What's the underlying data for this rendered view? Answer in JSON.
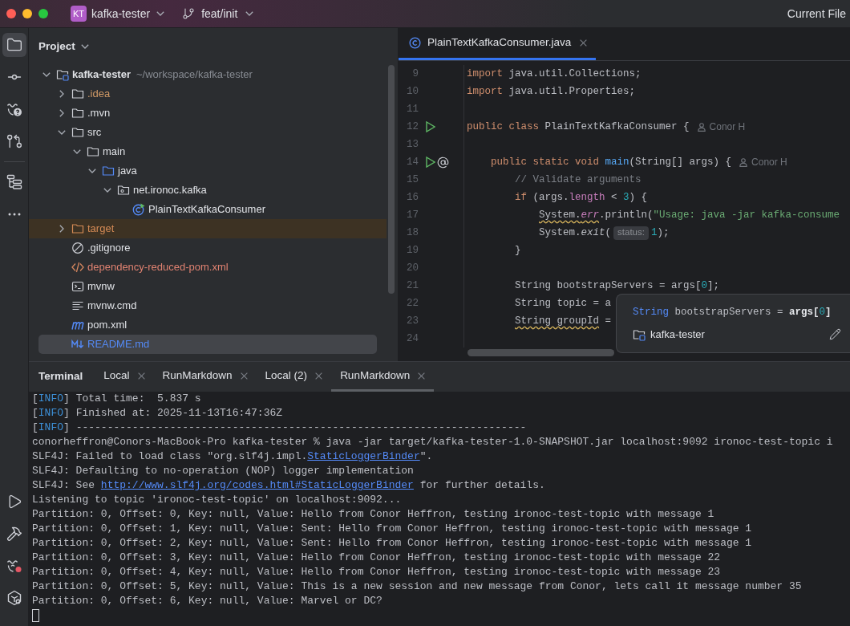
{
  "title_bar": {
    "project_badge": "KT",
    "project": "kafka-tester",
    "branch": "feat/init",
    "run_configuration": "Current File"
  },
  "tool_strip": {
    "top": [
      {
        "kind": "project",
        "selected": true
      },
      {
        "kind": "commit",
        "selected": false
      },
      {
        "kind": "problems",
        "selected": false
      },
      {
        "kind": "pull_requests",
        "selected": false
      },
      {
        "kind": "structure",
        "selected": false
      },
      {
        "kind": "more",
        "selected": false
      }
    ],
    "bottom": [
      {
        "kind": "run",
        "selected": false
      },
      {
        "kind": "build",
        "selected": false
      },
      {
        "kind": "problems_alert",
        "selected": false
      },
      {
        "kind": "services",
        "selected": false
      }
    ]
  },
  "project_panel": {
    "title": "Project",
    "tree": [
      {
        "label": "kafka-tester",
        "location": "~/workspace/kafka-tester",
        "kind": "module",
        "expanded": true,
        "selected": false,
        "color": "#dfe1e5",
        "children": [
          {
            "label": ".idea",
            "kind": "folder",
            "expanded": false,
            "selected": false,
            "color": "#d19a66"
          },
          {
            "label": ".mvn",
            "kind": "folder",
            "expanded": false,
            "selected": false,
            "color": "#dfe1e5"
          },
          {
            "label": "src",
            "kind": "folder",
            "expanded": true,
            "selected": false,
            "color": "#dfe1e5",
            "children": [
              {
                "label": "main",
                "kind": "folder",
                "expanded": true,
                "selected": false,
                "color": "#dfe1e5",
                "children": [
                  {
                    "label": "java",
                    "kind": "source_root",
                    "expanded": true,
                    "selected": false,
                    "color": "#dfe1e5",
                    "children": [
                      {
                        "label": "net.ironoc.kafka",
                        "kind": "package",
                        "expanded": true,
                        "selected": false,
                        "color": "#dfe1e5",
                        "children": [
                          {
                            "label": "PlainTextKafkaConsumer",
                            "kind": "class",
                            "selected": false,
                            "color": "#dfe1e5"
                          }
                        ]
                      }
                    ]
                  }
                ]
              }
            ]
          },
          {
            "label": "target",
            "kind": "excluded_folder",
            "expanded": false,
            "selected": false,
            "color": "#d48a55"
          },
          {
            "label": ".gitignore",
            "kind": "ignore_file",
            "selected": false,
            "color": "#dfe1e5"
          },
          {
            "label": "dependency-reduced-pom.xml",
            "kind": "xml_file",
            "selected": false,
            "color": "#e08271"
          },
          {
            "label": "mvnw",
            "kind": "script_file",
            "selected": false,
            "color": "#dfe1e5"
          },
          {
            "label": "mvnw.cmd",
            "kind": "text_file",
            "selected": false,
            "color": "#dfe1e5"
          },
          {
            "label": "pom.xml",
            "kind": "maven_file",
            "selected": false,
            "color": "#dfe1e5"
          },
          {
            "label": "README.md",
            "kind": "markdown_file",
            "selected": true,
            "color": "#548af7"
          }
        ]
      }
    ]
  },
  "editor": {
    "tabs": [
      {
        "label": "PlainTextKafkaConsumer.java",
        "selected": true
      }
    ],
    "lines": [
      {
        "number": "9",
        "tokens": [
          {
            "text": "import",
            "kind": "keyword"
          },
          {
            "text": " java.util.Collections;",
            "kind": "plain"
          }
        ]
      },
      {
        "number": "10",
        "tokens": [
          {
            "text": "import",
            "kind": "keyword"
          },
          {
            "text": " java.util.Properties;",
            "kind": "plain"
          }
        ]
      },
      {
        "number": "11"
      },
      {
        "number": "12",
        "markers": [
          {
            "kind": "run"
          }
        ],
        "tokens": [
          {
            "text": "public class",
            "kind": "keyword"
          },
          {
            "text": " PlainTextKafkaConsumer {",
            "kind": "plain"
          },
          {
            "text": "Conor H",
            "kind": "author"
          }
        ]
      },
      {
        "number": "13"
      },
      {
        "number": "14",
        "markers": [
          {
            "kind": "run"
          },
          {
            "kind": "implements"
          }
        ],
        "tokens": [
          {
            "text": "    public static void ",
            "kind": "keyword"
          },
          {
            "text": "main",
            "kind": "method"
          },
          {
            "text": "(String[] args) {",
            "kind": "plain"
          },
          {
            "text": "Conor H",
            "kind": "author"
          }
        ]
      },
      {
        "number": "15",
        "tokens": [
          {
            "text": "        // Validate arguments",
            "kind": "comment"
          }
        ]
      },
      {
        "number": "16",
        "tokens": [
          {
            "text": "        if",
            "kind": "keyword"
          },
          {
            "text": " (args.",
            "kind": "plain"
          },
          {
            "text": "length",
            "kind": "field"
          },
          {
            "text": " < ",
            "kind": "plain"
          },
          {
            "text": "3",
            "kind": "number"
          },
          {
            "text": ") {",
            "kind": "plain"
          }
        ]
      },
      {
        "number": "17",
        "tokens": [
          {
            "text": "            System.",
            "kind": "warning_plain"
          },
          {
            "text": "err",
            "kind": "warning_static_field"
          },
          {
            "text": ".println(",
            "kind": "plain"
          },
          {
            "text": "\"Usage: java -jar kafka-consume",
            "kind": "string"
          }
        ]
      },
      {
        "number": "18",
        "tokens": [
          {
            "text": "            System.",
            "kind": "plain"
          },
          {
            "text": "exit",
            "kind": "static_method"
          },
          {
            "text": "(",
            "kind": "plain"
          },
          {
            "text": "status:",
            "kind": "inlay"
          },
          {
            "text": "1",
            "kind": "number"
          },
          {
            "text": ");",
            "kind": "plain"
          }
        ]
      },
      {
        "number": "19",
        "tokens": [
          {
            "text": "        }",
            "kind": "plain"
          }
        ]
      },
      {
        "number": "20"
      },
      {
        "number": "21",
        "tokens": [
          {
            "text": "        String bootstrapServers = args[",
            "kind": "plain"
          },
          {
            "text": "0",
            "kind": "number"
          },
          {
            "text": "];",
            "kind": "plain"
          }
        ]
      },
      {
        "number": "22",
        "tokens": [
          {
            "text": "        String topic = a",
            "kind": "plain"
          }
        ]
      },
      {
        "number": "23",
        "tokens": [
          {
            "text": "        String groupId",
            "kind": "warning_plain"
          },
          {
            "text": " =",
            "kind": "plain"
          }
        ]
      },
      {
        "number": "24"
      }
    ],
    "popup": {
      "signature": [
        {
          "text": "String",
          "kind": "type"
        },
        {
          "text": " bootstrapServers = ",
          "kind": "plain"
        },
        {
          "text": "args[",
          "kind": "emphasis"
        },
        {
          "text": "0",
          "kind": "number"
        },
        {
          "text": "]",
          "kind": "emphasis"
        }
      ],
      "module": "kafka-tester"
    }
  },
  "terminal": {
    "title": "Terminal",
    "tabs": [
      {
        "label": "Local",
        "selected": false
      },
      {
        "label": "RunMarkdown",
        "selected": false
      },
      {
        "label": "Local (2)",
        "selected": false
      },
      {
        "label": "RunMarkdown",
        "selected": true
      }
    ],
    "lines": [
      {
        "segments": [
          {
            "text": "[",
            "kind": "plain"
          },
          {
            "text": "INFO",
            "kind": "info"
          },
          {
            "text": "] Total time:  5.837 s",
            "kind": "plain"
          }
        ]
      },
      {
        "segments": [
          {
            "text": "[",
            "kind": "plain"
          },
          {
            "text": "INFO",
            "kind": "info"
          },
          {
            "text": "] Finished at: 2025-11-13T16:47:36Z",
            "kind": "plain"
          }
        ]
      },
      {
        "segments": [
          {
            "text": "[",
            "kind": "plain"
          },
          {
            "text": "INFO",
            "kind": "info"
          },
          {
            "text": "] ------------------------------------------------------------------------",
            "kind": "plain"
          }
        ]
      },
      {
        "segments": [
          {
            "text": "conorheffron@Conors-MacBook-Pro kafka-tester % java -jar target/kafka-tester-1.0-SNAPSHOT.jar localhost:9092 ironoc-test-topic i",
            "kind": "plain"
          }
        ]
      },
      {
        "segments": [
          {
            "text": "SLF4J: Failed to load class \"org.slf4j.impl.",
            "kind": "plain"
          },
          {
            "text": "StaticLoggerBinder",
            "kind": "link"
          },
          {
            "text": "\".",
            "kind": "plain"
          }
        ]
      },
      {
        "segments": [
          {
            "text": "SLF4J: Defaulting to no-operation (NOP) logger implementation",
            "kind": "plain"
          }
        ]
      },
      {
        "segments": [
          {
            "text": "SLF4J: See ",
            "kind": "plain"
          },
          {
            "text": "http://www.slf4j.org/codes.html#StaticLoggerBinder",
            "kind": "link"
          },
          {
            "text": " for further details.",
            "kind": "plain"
          }
        ]
      },
      {
        "segments": [
          {
            "text": "Listening to topic 'ironoc-test-topic' on localhost:9092...",
            "kind": "plain"
          }
        ]
      },
      {
        "segments": [
          {
            "text": "Partition: 0, Offset: 0, Key: null, Value: Hello from Conor Heffron, testing ironoc-test-topic with message 1",
            "kind": "plain"
          }
        ]
      },
      {
        "segments": [
          {
            "text": "Partition: 0, Offset: 1, Key: null, Value: Sent: Hello from Conor Heffron, testing ironoc-test-topic with message 1",
            "kind": "plain"
          }
        ]
      },
      {
        "segments": [
          {
            "text": "Partition: 0, Offset: 2, Key: null, Value: Sent: Hello from Conor Heffron, testing ironoc-test-topic with message 1",
            "kind": "plain"
          }
        ]
      },
      {
        "segments": [
          {
            "text": "Partition: 0, Offset: 3, Key: null, Value: Hello from Conor Heffron, testing ironoc-test-topic with message 22",
            "kind": "plain"
          }
        ]
      },
      {
        "segments": [
          {
            "text": "Partition: 0, Offset: 4, Key: null, Value: Hello from Conor Heffron, testing ironoc-test-topic with message 23",
            "kind": "plain"
          }
        ]
      },
      {
        "segments": [
          {
            "text": "Partition: 0, Offset: 5, Key: null, Value: This is a new session and new message from Conor, lets call it message number 35",
            "kind": "plain"
          }
        ]
      },
      {
        "segments": [
          {
            "text": "Partition: 0, Offset: 6, Key: null, Value: Marvel or DC?",
            "kind": "plain"
          }
        ]
      }
    ]
  }
}
